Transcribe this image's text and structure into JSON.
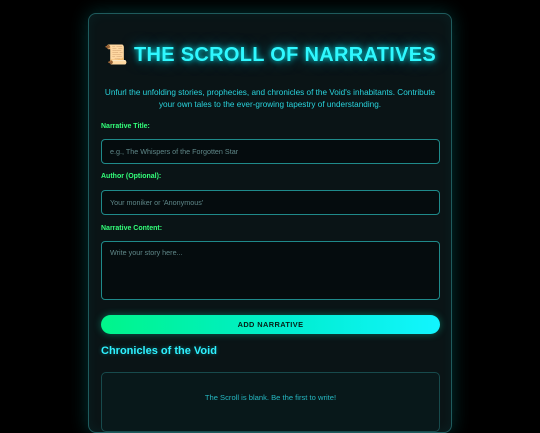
{
  "header": {
    "icon": "scroll-icon",
    "icon_glyph": "📜",
    "title": "THE SCROLL OF NARRATIVES",
    "intro": "Unfurl the unfolding stories, prophecies, and chronicles of the Void's inhabitants. Contribute your own tales to the ever-growing tapestry of understanding."
  },
  "form": {
    "title_label": "Narrative Title:",
    "title_placeholder": "e.g., The Whispers of the Forgotten Star",
    "title_value": "",
    "author_label": "Author (Optional):",
    "author_placeholder": "Your moniker or 'Anonymous'",
    "author_value": "",
    "content_label": "Narrative Content:",
    "content_placeholder": "Write your story here...",
    "content_value": "",
    "submit_label": "ADD NARRATIVE"
  },
  "chronicles": {
    "heading": "Chronicles of the Void",
    "empty_message": "The Scroll is blank. Be the first to write!"
  },
  "colors": {
    "accent_cyan": "#2ff8ff",
    "label_green": "#33ff7a",
    "button_gradient_start": "#00f58a",
    "button_gradient_end": "#12f5ff",
    "background": "#000000",
    "panel": "#0a1416"
  }
}
